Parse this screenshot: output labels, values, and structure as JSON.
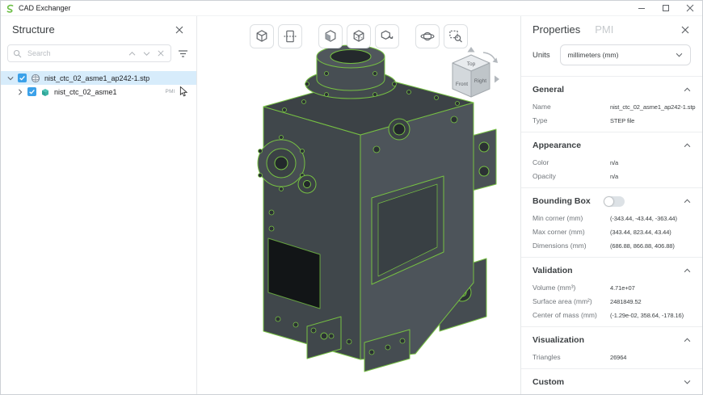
{
  "window": {
    "title": "CAD Exchanger"
  },
  "structure": {
    "title": "Structure",
    "search": {
      "placeholder": "Search"
    },
    "rows": [
      {
        "label": "nist_ctc_02_asme1_ap242-1.stp"
      },
      {
        "label": "nist_ctc_02_asme1",
        "badge": "PMI"
      }
    ]
  },
  "viewport": {
    "toolbar_buttons": [
      "isometric-view",
      "clip-plane",
      "shaded-mode",
      "wireframe-mode",
      "ghost-mode",
      "orbit-rotate",
      "zoom-window"
    ],
    "viewcube": {
      "top": "Top",
      "left": "Front",
      "right": "Right"
    }
  },
  "properties": {
    "tabs": [
      {
        "label": "Properties"
      },
      {
        "label": "PMI"
      }
    ],
    "units": {
      "label": "Units",
      "value": "millimeters (mm)"
    },
    "sections": [
      {
        "title": "General",
        "rows": [
          {
            "label": "Name",
            "value": "nist_ctc_02_asme1_ap242-1.stp"
          },
          {
            "label": "Type",
            "value": "STEP file"
          }
        ]
      },
      {
        "title": "Appearance",
        "rows": [
          {
            "label": "Color",
            "value": "n/a"
          },
          {
            "label": "Opacity",
            "value": "n/a"
          }
        ]
      },
      {
        "title": "Bounding Box",
        "toggle": "off",
        "rows": [
          {
            "label": "Min corner (mm)",
            "value": "(-343.44, -43.44, -363.44)"
          },
          {
            "label": "Max corner (mm)",
            "value": "(343.44, 823.44, 43.44)"
          },
          {
            "label": "Dimensions (mm)",
            "value": "(686.88, 866.88, 406.88)"
          }
        ]
      },
      {
        "title": "Validation",
        "rows": [
          {
            "label": "Volume (mm³)",
            "value": "4.71e+07"
          },
          {
            "label": "Surface area (mm²)",
            "value": "2481849.52"
          },
          {
            "label": "Center of mass (mm)",
            "value": "(-1.29e-02, 358.64, -178.16)"
          }
        ]
      },
      {
        "title": "Visualization",
        "rows": [
          {
            "label": "Triangles",
            "value": "26964"
          }
        ]
      },
      {
        "title": "Custom",
        "rows": []
      }
    ]
  },
  "colors": {
    "accent_blue": "#3ba1e9",
    "highlight_green": "#76c043",
    "selected_row": "#d7ecfb",
    "model_gray": "#454c51"
  }
}
